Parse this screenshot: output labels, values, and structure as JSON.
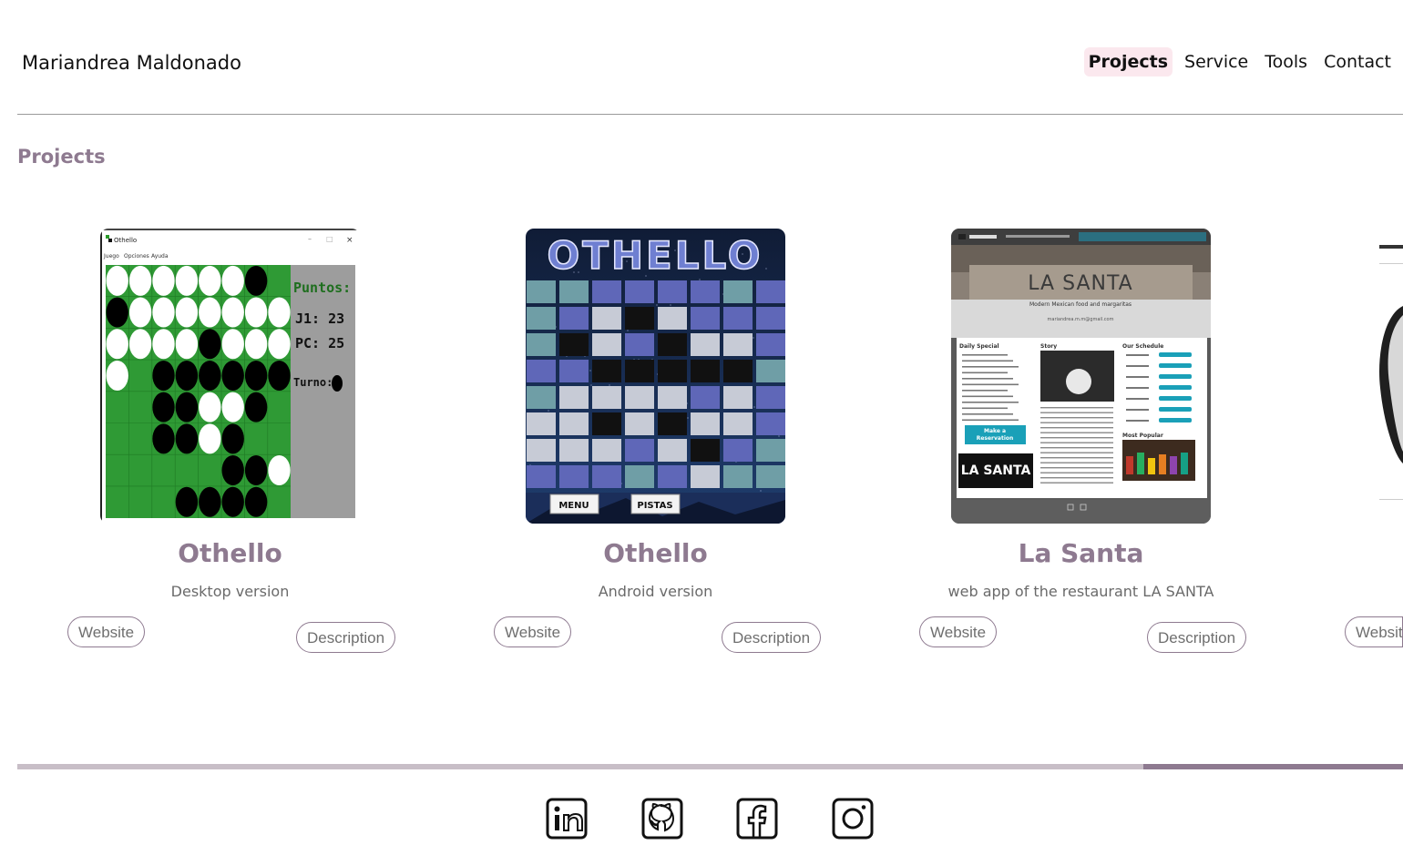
{
  "header": {
    "brand": "Mariandrea Maldonado",
    "nav": [
      {
        "label": "Projects",
        "active": true
      },
      {
        "label": "Service",
        "active": false
      },
      {
        "label": "Tools",
        "active": false
      },
      {
        "label": "Contact",
        "active": false
      }
    ]
  },
  "section": {
    "title": "Projects"
  },
  "projects": [
    {
      "title": "Othello",
      "subtitle": "Desktop version",
      "website_label": "Website",
      "description_label": "Description",
      "thumb": {
        "window_title": "Othello",
        "menu": [
          "Juego",
          "Opciones",
          "Ayuda"
        ],
        "score_title": "Puntos:",
        "j1": "J1: 23",
        "pc": "PC: 25",
        "turn": "Turno:"
      }
    },
    {
      "title": "Othello",
      "subtitle": "Android version",
      "website_label": "Website",
      "description_label": "Description",
      "thumb": {
        "logo": "OTHELLO",
        "menu_btn": "MENU",
        "hints_btn": "PISTAS"
      }
    },
    {
      "title": "La Santa",
      "subtitle": "web app of the restaurant LA SANTA",
      "website_label": "Website",
      "description_label": "Description",
      "thumb": {
        "hero": "LA SANTA",
        "tagline": "Modern Mexican food and margaritas",
        "email": "mariandrea.m.m@gmail.com",
        "col1": "Daily Special",
        "col2": "Story",
        "col3": "Our Schedule",
        "reserve": "Make a Reservation",
        "logo": "LA SANTA",
        "popular": "Most Popular"
      }
    },
    {
      "title": "",
      "subtitle": "",
      "website_label": "Websit",
      "description_label": ""
    }
  ],
  "footer": {
    "progress_fraction": 0.8,
    "social_icons": [
      "linkedin-icon",
      "github-icon",
      "facebook-icon",
      "instagram-icon"
    ]
  },
  "colors": {
    "accent": "#8e7a90",
    "nav_active_bg": "#fbe8ee",
    "rule": "#9a9a9a",
    "progress_track": "#c8bec7"
  }
}
